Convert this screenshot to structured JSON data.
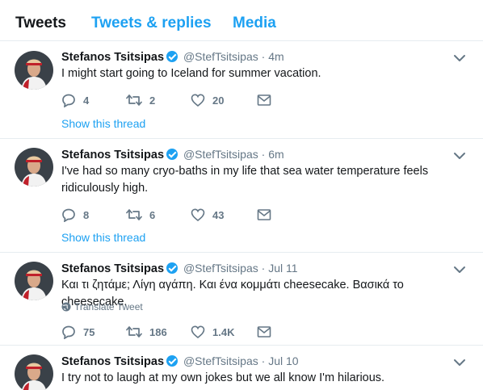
{
  "tabs": [
    {
      "label": "Tweets",
      "active": true
    },
    {
      "label": "Tweets & replies",
      "active": false
    },
    {
      "label": "Media",
      "active": false
    }
  ],
  "colors": {
    "accent": "#1da1f2",
    "muted": "#657786",
    "text": "#14171a",
    "divider": "#e6ecf0"
  },
  "tweets": [
    {
      "name": "Stefanos Tsitsipas",
      "handle": "@StefTsitsipas",
      "dot": "·",
      "time": "4m",
      "text": "I might start going to Iceland for summer vacation.",
      "replies": "4",
      "retweets": "2",
      "likes": "20",
      "show_thread": "Show this thread"
    },
    {
      "name": "Stefanos Tsitsipas",
      "handle": "@StefTsitsipas",
      "dot": "·",
      "time": "6m",
      "text": "I've had so many cryo-baths in my life that sea water temperature feels ridiculously high.",
      "replies": "8",
      "retweets": "6",
      "likes": "43",
      "show_thread": "Show this thread"
    },
    {
      "name": "Stefanos Tsitsipas",
      "handle": "@StefTsitsipas",
      "dot": "·",
      "time": "Jul 11",
      "text": "Και τι ζητάμε; Λίγη αγάπη. Και ένα κομμάτι cheesecake. Βασικά το cheesecake.",
      "translate": "Translate Tweet",
      "replies": "75",
      "retweets": "186",
      "likes": "1.4K"
    },
    {
      "name": "Stefanos Tsitsipas",
      "handle": "@StefTsitsipas",
      "dot": "·",
      "time": "Jul 10",
      "text": "I try not to laugh at my own jokes but we all know I'm hilarious."
    }
  ]
}
